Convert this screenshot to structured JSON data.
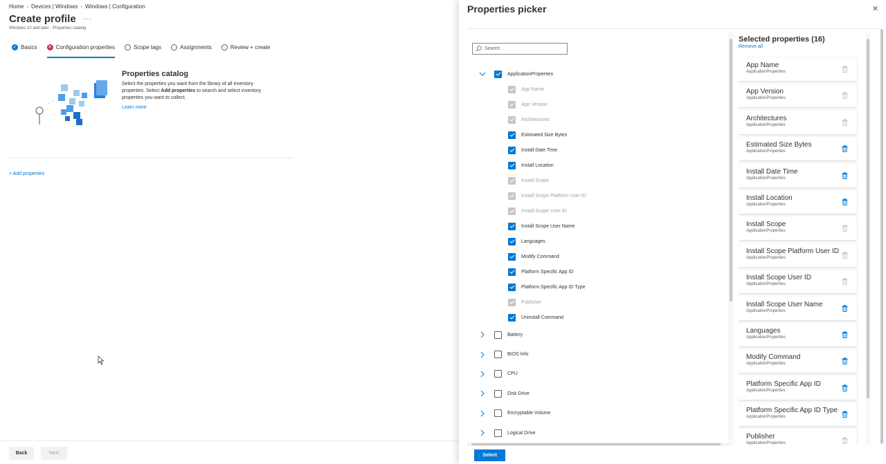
{
  "breadcrumb": [
    "Home",
    "Devices | Windows",
    "Windows | Configuration"
  ],
  "page": {
    "title": "Create profile",
    "more": "···",
    "subtitle": "Windows 10 and later - Properties catalog"
  },
  "steps": [
    {
      "label": "Basics",
      "state": "done"
    },
    {
      "label": "Configuration properties",
      "state": "error"
    },
    {
      "label": "Scope tags",
      "state": "empty"
    },
    {
      "label": "Assignments",
      "state": "empty"
    },
    {
      "label": "Review + create",
      "state": "empty"
    }
  ],
  "catalog": {
    "title": "Properties catalog",
    "desc_1": "Select the properties you want from the library of all inventory properties. Select ",
    "desc_bold": "Add properties",
    "desc_2": " to search and select inventory properties you want to collect.",
    "learn_more": "Learn more"
  },
  "add_properties": "+ Add properties",
  "footer": {
    "back": "Back",
    "next": "Next"
  },
  "panel": {
    "title": "Properties picker",
    "close": "✕",
    "search_placeholder": "Search",
    "select_button": "Select",
    "tree_parent": "ApplicationProperties",
    "tree_children": [
      {
        "label": "App Name",
        "state": "disabled"
      },
      {
        "label": "App Version",
        "state": "disabled"
      },
      {
        "label": "Architectures",
        "state": "disabled"
      },
      {
        "label": "Estimated Size Bytes",
        "state": "checked"
      },
      {
        "label": "Install Date Time",
        "state": "checked"
      },
      {
        "label": "Install Location",
        "state": "checked"
      },
      {
        "label": "Install Scope",
        "state": "disabled"
      },
      {
        "label": "Install Scope Platform User ID",
        "state": "disabled"
      },
      {
        "label": "Install Scope User ID",
        "state": "disabled"
      },
      {
        "label": "Install Scope User Name",
        "state": "checked"
      },
      {
        "label": "Languages",
        "state": "checked"
      },
      {
        "label": "Modify Command",
        "state": "checked"
      },
      {
        "label": "Platform Specific App ID",
        "state": "checked"
      },
      {
        "label": "Platform Specific App ID Type",
        "state": "checked"
      },
      {
        "label": "Publisher",
        "state": "disabled"
      },
      {
        "label": "Uninstall Command",
        "state": "checked"
      }
    ],
    "tree_collapsed": [
      "Battery",
      "BIOS Info",
      "CPU",
      "Disk Drive",
      "Encryptable Volume",
      "Logical Drive"
    ],
    "selected_title": "Selected properties (16)",
    "remove_all": "Remove all",
    "selected": [
      {
        "name": "App Name",
        "category": "ApplicationProperties",
        "deletable": false
      },
      {
        "name": "App Version",
        "category": "ApplicationProperties",
        "deletable": false
      },
      {
        "name": "Architectures",
        "category": "ApplicationProperties",
        "deletable": false
      },
      {
        "name": "Estimated Size Bytes",
        "category": "ApplicationProperties",
        "deletable": true
      },
      {
        "name": "Install Date Time",
        "category": "ApplicationProperties",
        "deletable": true
      },
      {
        "name": "Install Location",
        "category": "ApplicationProperties",
        "deletable": true
      },
      {
        "name": "Install Scope",
        "category": "ApplicationProperties",
        "deletable": false
      },
      {
        "name": "Install Scope Platform User ID",
        "category": "ApplicationProperties",
        "deletable": false
      },
      {
        "name": "Install Scope User ID",
        "category": "ApplicationProperties",
        "deletable": false
      },
      {
        "name": "Install Scope User Name",
        "category": "ApplicationProperties",
        "deletable": true
      },
      {
        "name": "Languages",
        "category": "ApplicationProperties",
        "deletable": true
      },
      {
        "name": "Modify Command",
        "category": "ApplicationProperties",
        "deletable": true
      },
      {
        "name": "Platform Specific App ID",
        "category": "ApplicationProperties",
        "deletable": true
      },
      {
        "name": "Platform Specific App ID Type",
        "category": "ApplicationProperties",
        "deletable": true
      },
      {
        "name": "Publisher",
        "category": "ApplicationProperties",
        "deletable": false
      }
    ]
  },
  "colors": {
    "accent": "#0078d4",
    "error": "#c4314b",
    "disabled": "#c8c6c4",
    "delete_icon": "#0078d4",
    "delete_icon_disabled": "#c8c6c4"
  }
}
